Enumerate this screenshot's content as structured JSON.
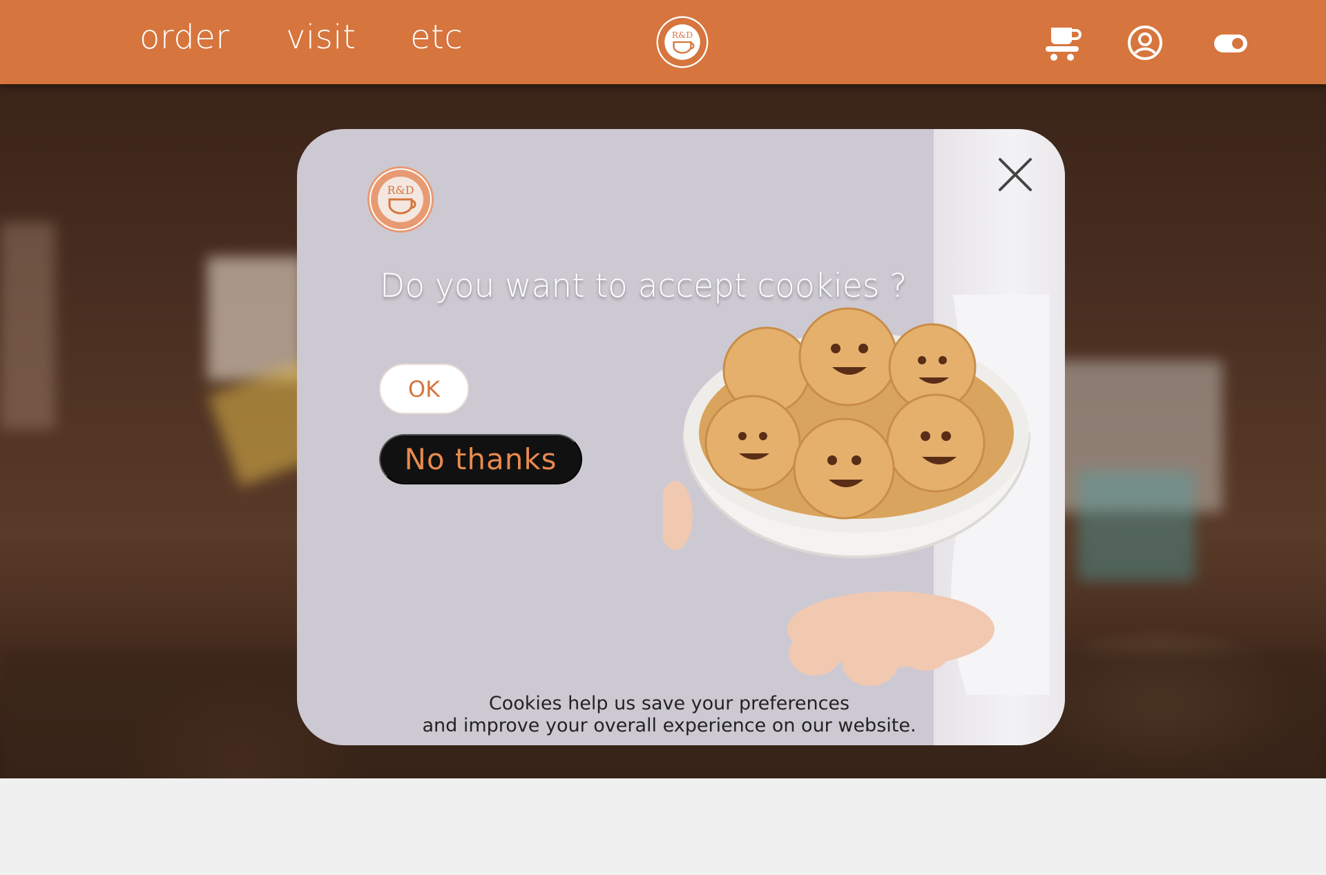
{
  "nav": {
    "links": [
      {
        "label": "order"
      },
      {
        "label": "visit"
      },
      {
        "label": "etc"
      }
    ],
    "icons": {
      "logo": "redmud-coffee-logo",
      "cart": "coffee-cart-icon",
      "account": "account-icon",
      "toggle": "theme-toggle-icon"
    }
  },
  "modal": {
    "title": "Do you want to accept cookies ?",
    "ok_label": "OK",
    "no_label": "No thanks",
    "footer_line1": "Cookies help us save your preferences",
    "footer_line2": "and improve your overall experience on our website.",
    "close_icon": "close-icon"
  },
  "colors": {
    "brand": "#d6753d",
    "modal_bg": "#cdc9d3",
    "dark_button": "#111111"
  }
}
